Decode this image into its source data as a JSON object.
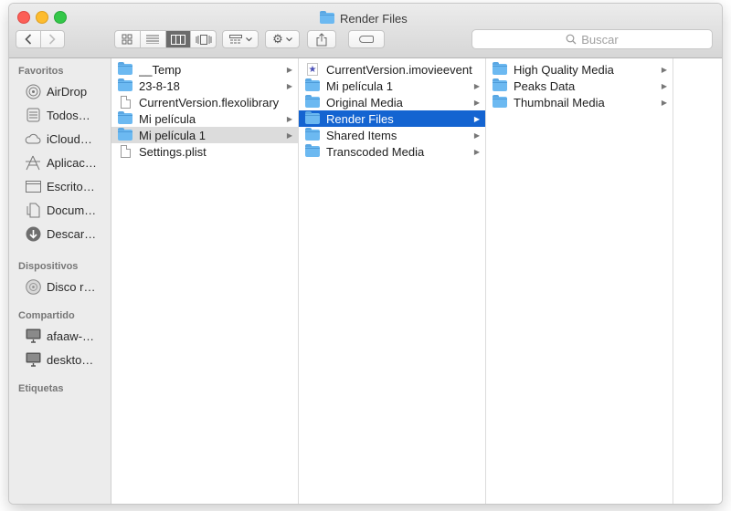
{
  "window": {
    "title": "Render Files"
  },
  "toolbar": {
    "back_icon": "chevron-left-icon",
    "forward_icon": "chevron-right-icon",
    "view_icons": [
      "icon-view-icon",
      "list-view-icon",
      "column-view-icon",
      "cover-flow-icon"
    ],
    "active_view": "column-view",
    "search_placeholder": "Buscar"
  },
  "sidebar": {
    "sections": [
      {
        "label": "Favoritos"
      },
      {
        "label": "Dispositivos"
      },
      {
        "label": "Compartido"
      },
      {
        "label": "Etiquetas"
      }
    ],
    "favorites": [
      {
        "label": "AirDrop",
        "icon": "airdrop-icon"
      },
      {
        "label": "Todos…",
        "icon": "all-files-icon"
      },
      {
        "label": "iCloud…",
        "icon": "icloud-icon"
      },
      {
        "label": "Aplicac…",
        "icon": "applications-icon"
      },
      {
        "label": "Escrito…",
        "icon": "desktop-icon"
      },
      {
        "label": "Docum…",
        "icon": "documents-icon"
      },
      {
        "label": "Descar…",
        "icon": "downloads-icon"
      }
    ],
    "devices": [
      {
        "label": "Disco r…",
        "icon": "disc-icon"
      }
    ],
    "shared": [
      {
        "label": "afaaw-…",
        "icon": "computer-icon"
      },
      {
        "label": "deskto…",
        "icon": "computer-icon"
      }
    ]
  },
  "columns": [
    {
      "items": [
        {
          "name": "__Temp",
          "kind": "folder",
          "has_children": true
        },
        {
          "name": "23-8-18",
          "kind": "folder",
          "has_children": true
        },
        {
          "name": "CurrentVersion.flexolibrary",
          "kind": "file",
          "has_children": false
        },
        {
          "name": "Mi película",
          "kind": "folder",
          "has_children": true
        },
        {
          "name": "Mi película 1",
          "kind": "folder",
          "has_children": true,
          "selected": "inactive"
        },
        {
          "name": "Settings.plist",
          "kind": "file",
          "has_children": false
        }
      ]
    },
    {
      "items": [
        {
          "name": "CurrentVersion.imovieevent",
          "kind": "imovie",
          "has_children": false
        },
        {
          "name": "Mi película 1",
          "kind": "folder",
          "has_children": true
        },
        {
          "name": "Original Media",
          "kind": "folder",
          "has_children": true
        },
        {
          "name": "Render Files",
          "kind": "folder",
          "has_children": true,
          "selected": "active"
        },
        {
          "name": "Shared Items",
          "kind": "folder",
          "has_children": true
        },
        {
          "name": "Transcoded Media",
          "kind": "folder",
          "has_children": true
        }
      ]
    },
    {
      "items": [
        {
          "name": "High Quality Media",
          "kind": "folder",
          "has_children": true
        },
        {
          "name": "Peaks Data",
          "kind": "folder",
          "has_children": true
        },
        {
          "name": "Thumbnail Media",
          "kind": "folder",
          "has_children": true
        }
      ]
    }
  ],
  "colors": {
    "selection": "#1464d1",
    "inactive_selection": "#dcdcdc",
    "folder": "#6cb9f1"
  }
}
